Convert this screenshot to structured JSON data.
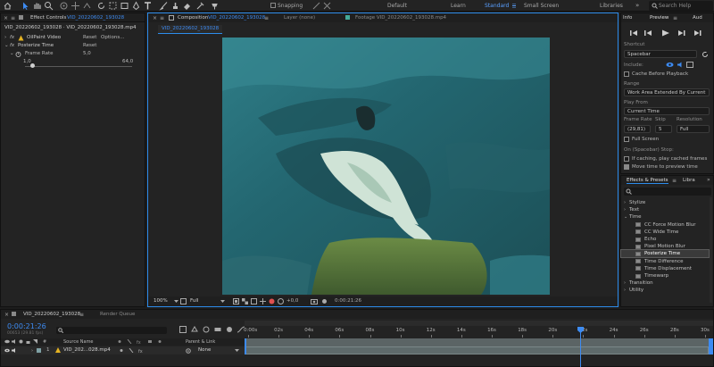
{
  "topbar": {
    "snapping_label": "Snapping",
    "workspaces": [
      "Default",
      "Learn",
      "Standard",
      "Small Screen",
      "Libraries"
    ],
    "active_workspace": "Standard",
    "search_placeholder": "Search Help"
  },
  "effect_controls": {
    "panel_title": "Effect Controls",
    "panel_file": "VID_20220602_193028",
    "breadcrumb": "VID_20220602_193028 · VID_20220602_193028.mp4",
    "effects": [
      {
        "name": "OilPaint Video",
        "reset": "Reset",
        "options": "Options..."
      },
      {
        "name": "Posterize Time",
        "reset": "Reset"
      }
    ],
    "param_label": "Frame Rate",
    "param_value": "5,0",
    "slider_min": "1,0",
    "slider_max": "64,0"
  },
  "composition": {
    "tab_prefix": "Composition",
    "tab_name": "VID_20220602_193028",
    "layer_tab": "Layer (none)",
    "footage_tab": "Footage VID_20220602_193028.mp4",
    "comp_button": "VID_20220602_193028",
    "zoom": "100%",
    "resolution": "Full",
    "exposure": "+0,0",
    "timecode": "0:00:21:26"
  },
  "preview": {
    "info_tab": "Info",
    "preview_tab": "Preview",
    "audio_tab": "Aud",
    "shortcut_label": "Shortcut",
    "shortcut_value": "Spacebar",
    "include_label": "Include:",
    "cache_label": "Cache Before Playback",
    "range_label": "Range",
    "range_value": "Work Area Extended By Current ...",
    "play_from_label": "Play From",
    "play_from_value": "Current Time",
    "frame_rate_label": "Frame Rate",
    "skip_label": "Skip",
    "resolution_label": "Resolution",
    "frame_rate_value": "(29,81)",
    "skip_value": "5",
    "resolution_value": "Full",
    "full_screen_label": "Full Screen",
    "stop_label": "On (Spacebar) Stop:",
    "if_caching_label": "If caching, play cached frames",
    "move_time_label": "Move time to preview time"
  },
  "effects_presets": {
    "tab": "Effects & Presets",
    "lib_tab": "Libra",
    "search_placeholder": "",
    "items": [
      {
        "label": "Stylize",
        "type": "category"
      },
      {
        "label": "Text",
        "type": "category"
      },
      {
        "label": "Time",
        "type": "category-open"
      },
      {
        "label": "CC Force Motion Blur",
        "type": "effect"
      },
      {
        "label": "CC Wide Time",
        "type": "effect"
      },
      {
        "label": "Echo",
        "type": "effect"
      },
      {
        "label": "Pixel Motion Blur",
        "type": "effect"
      },
      {
        "label": "Posterize Time",
        "type": "effect-selected"
      },
      {
        "label": "Time Difference",
        "type": "effect"
      },
      {
        "label": "Time Displacement",
        "type": "effect"
      },
      {
        "label": "Timewarp",
        "type": "effect"
      },
      {
        "label": "Transition",
        "type": "category"
      },
      {
        "label": "Utility",
        "type": "category"
      }
    ]
  },
  "timeline": {
    "comp_tab": "VID_20220602_193028",
    "render_queue_tab": "Render Queue",
    "timecode": "0:00:21:26",
    "timecode_sub": "00653 (29.81 fps)",
    "col_source": "Source Name",
    "col_parent": "Parent & Link",
    "layer_number": "1",
    "layer_name": "VID_202...028.mp4",
    "parent_value": "None",
    "ruler": [
      "0:00s",
      "02s",
      "04s",
      "06s",
      "08s",
      "10s",
      "12s",
      "14s",
      "16s",
      "18s",
      "20s",
      "22s",
      "24s",
      "26s",
      "28s",
      "30s"
    ],
    "playhead_fraction": 0.727
  },
  "colors": {
    "accent": "#2d8ceb",
    "panel_bg": "#232323",
    "comp_border": "#2d8ceb",
    "teal": "#2b6b73",
    "clip_bar": "#5e6a6b"
  }
}
